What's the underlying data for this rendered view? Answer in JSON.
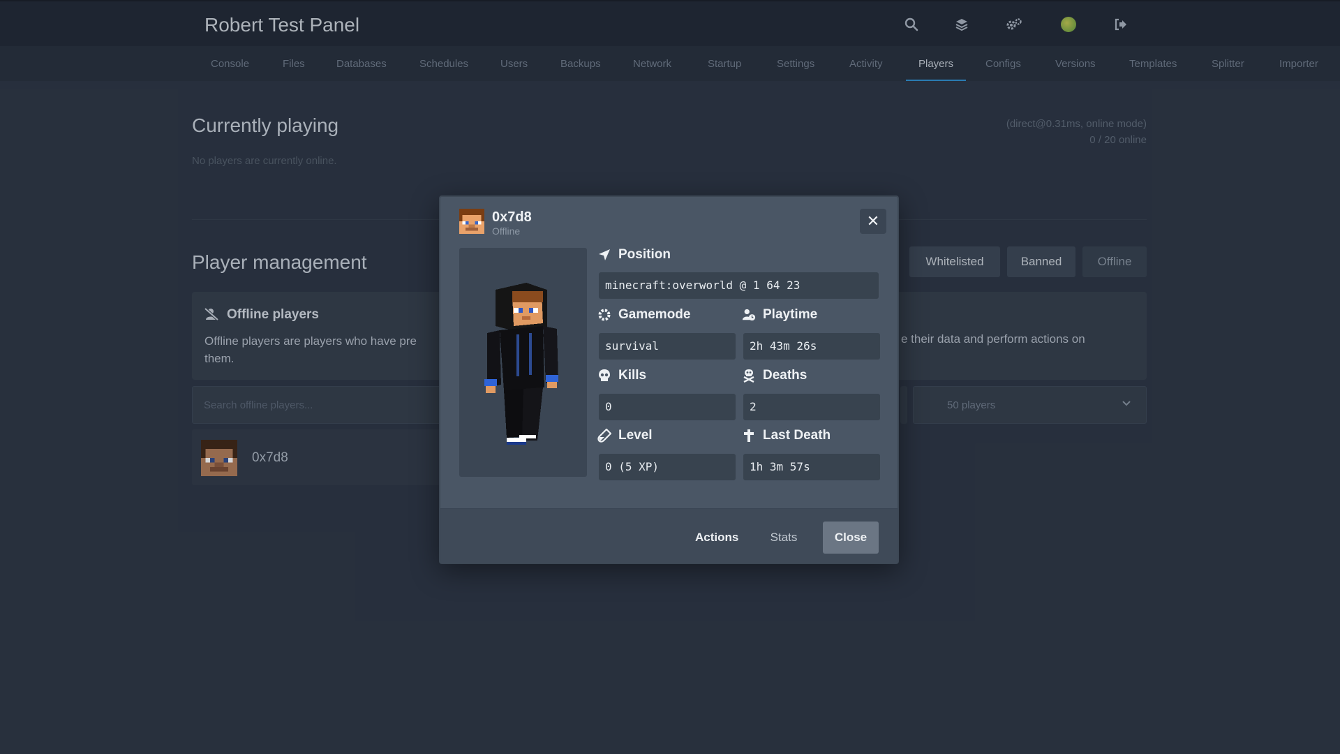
{
  "header": {
    "title": "Robert Test Panel",
    "icons": [
      "search-icon",
      "layers-icon",
      "gears-icon",
      "avatar",
      "logout-icon"
    ]
  },
  "tabs": [
    {
      "label": "Console"
    },
    {
      "label": "Files"
    },
    {
      "label": "Databases"
    },
    {
      "label": "Schedules"
    },
    {
      "label": "Users"
    },
    {
      "label": "Backups"
    },
    {
      "label": "Network"
    },
    {
      "label": "Startup"
    },
    {
      "label": "Settings"
    },
    {
      "label": "Activity"
    },
    {
      "label": "Players",
      "active": true
    },
    {
      "label": "Configs"
    },
    {
      "label": "Versions"
    },
    {
      "label": "Templates"
    },
    {
      "label": "Splitter"
    },
    {
      "label": "Importer"
    }
  ],
  "playing": {
    "title": "Currently playing",
    "empty_text": "No players are currently online.",
    "connection": "(direct@0.31ms, online mode)",
    "count": "0 / 20 online"
  },
  "management": {
    "title": "Player management",
    "filters": [
      "Whitelisted",
      "Banned",
      "Offline"
    ],
    "card_title": "Offline players",
    "card_text_left": "Offline players are players who have pre",
    "card_text_left_2": "them.",
    "card_text_right": "e their data and perform actions on",
    "search_placeholder": "Search offline players...",
    "per_page": "50 players",
    "players": [
      {
        "name": "0x7d8"
      }
    ]
  },
  "modal": {
    "player_name": "0x7d8",
    "status": "Offline",
    "fields": {
      "position": {
        "label": "Position",
        "value": "minecraft:overworld @ 1 64 23"
      },
      "gamemode": {
        "label": "Gamemode",
        "value": "survival"
      },
      "playtime": {
        "label": "Playtime",
        "value": "2h 43m 26s"
      },
      "kills": {
        "label": "Kills",
        "value": "0"
      },
      "deaths": {
        "label": "Deaths",
        "value": "2"
      },
      "level": {
        "label": "Level",
        "value": "0 (5 XP)"
      },
      "last_death": {
        "label": "Last Death",
        "value": "1h 3m 57s"
      }
    },
    "buttons": {
      "actions": "Actions",
      "stats": "Stats",
      "close": "Close"
    }
  },
  "colors": {
    "background": "#2a3341",
    "topbar": "#1f2732",
    "accent": "#2e8fd0",
    "modal": "#4a5665"
  }
}
